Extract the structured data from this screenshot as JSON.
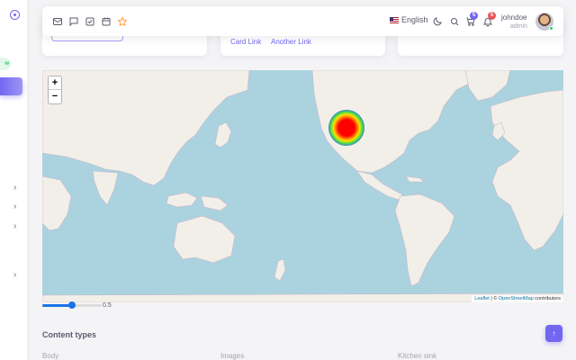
{
  "sidebar": {
    "badge_text": "w",
    "chevron": "›"
  },
  "cards": {
    "card_link": "Card Link",
    "another_link": "Another Link"
  },
  "navbar": {
    "icons": [
      "mail-icon",
      "chat-icon",
      "checkbox-icon",
      "calendar-icon",
      "star-icon"
    ],
    "language": "English",
    "cart_count": "5",
    "notification_count": "5",
    "username": "johndoe",
    "role": "admin"
  },
  "map": {
    "zoom_in": "+",
    "zoom_out": "−",
    "attribution_leaflet": "Leaflet",
    "attribution_sep": "| ©",
    "attribution_osm": "OpenStreetMap",
    "attribution_tail": "contributors"
  },
  "slider": {
    "value": "0.5",
    "fraction": 0.5
  },
  "content": {
    "section_title": "Content types",
    "scroll_top_icon": "↑",
    "bottom_labels": [
      "Body",
      "Images",
      "Kitchen sink"
    ]
  },
  "colors": {
    "accent": "#7367f0",
    "success": "#28c76f",
    "water": "#aad3df",
    "land": "#f2efe9"
  }
}
